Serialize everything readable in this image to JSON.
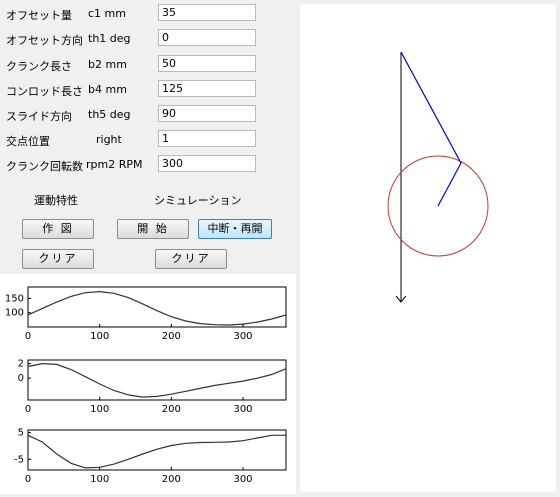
{
  "params": [
    {
      "label": "オフセット量",
      "unit": "c1  mm",
      "value": "35"
    },
    {
      "label": "オフセット方向",
      "unit": "th1 deg",
      "value": "0"
    },
    {
      "label": "クランク長さ",
      "unit": "b2  mm",
      "value": "50"
    },
    {
      "label": "コンロッド長さ",
      "unit": "b4  mm",
      "value": "125"
    },
    {
      "label": "スライド方向",
      "unit": "th5 deg",
      "value": "90"
    },
    {
      "label": "交点位置",
      "unit": "right",
      "value": "1"
    },
    {
      "label": "クランク回転数",
      "unit": "rpm2 RPM",
      "value": "300"
    }
  ],
  "sections": {
    "kinematics": "運動特性",
    "simulation": "シミュレーション"
  },
  "buttons": {
    "plot": "作 図",
    "clear_left": "クリア",
    "start": "開 始",
    "pause_resume": "中断・再開",
    "clear_right": "クリア"
  },
  "chart_data": [
    {
      "type": "line",
      "name": "plot1",
      "x": [
        0,
        20,
        40,
        60,
        80,
        100,
        120,
        140,
        160,
        180,
        200,
        220,
        240,
        260,
        280,
        300,
        320,
        340,
        360
      ],
      "y": [
        92,
        115,
        137,
        157,
        170,
        174,
        168,
        153,
        131,
        107,
        86,
        71,
        62,
        58,
        57,
        60,
        67,
        78,
        92
      ],
      "xlim": [
        0,
        360
      ],
      "ylim": [
        50,
        190
      ],
      "xticks": [
        "0",
        "100",
        "200",
        "300"
      ],
      "yticks": [
        "150",
        "100"
      ]
    },
    {
      "type": "line",
      "name": "plot2",
      "x": [
        0,
        20,
        40,
        60,
        80,
        100,
        120,
        140,
        160,
        180,
        200,
        220,
        240,
        260,
        280,
        300,
        320,
        340,
        360
      ],
      "y": [
        1.6,
        2.0,
        1.9,
        1.2,
        0.2,
        -0.8,
        -1.7,
        -2.3,
        -2.6,
        -2.5,
        -2.2,
        -1.8,
        -1.4,
        -1.0,
        -0.7,
        -0.4,
        0.0,
        0.5,
        1.3
      ],
      "xlim": [
        0,
        360
      ],
      "ylim": [
        -3,
        2.5
      ],
      "xticks": [
        "0",
        "100",
        "200",
        "300"
      ],
      "yticks": [
        "2",
        "0"
      ]
    },
    {
      "type": "line",
      "name": "plot3",
      "x": [
        0,
        20,
        40,
        60,
        80,
        100,
        120,
        140,
        160,
        180,
        200,
        220,
        240,
        260,
        280,
        300,
        320,
        340,
        360
      ],
      "y": [
        4,
        1.5,
        -3,
        -6.5,
        -8.2,
        -8,
        -6.8,
        -5,
        -3,
        -1.2,
        0.2,
        1,
        1.3,
        1.4,
        1.5,
        2,
        3,
        4,
        4
      ],
      "xlim": [
        0,
        360
      ],
      "ylim": [
        -9,
        6
      ],
      "xticks": [
        "0",
        "100",
        "200",
        "300"
      ],
      "yticks": [
        "5",
        "-5"
      ]
    }
  ],
  "mechanism": {
    "link_color": "#0000cc",
    "circle_color": "#cc3333",
    "axis_color": "#000000"
  }
}
